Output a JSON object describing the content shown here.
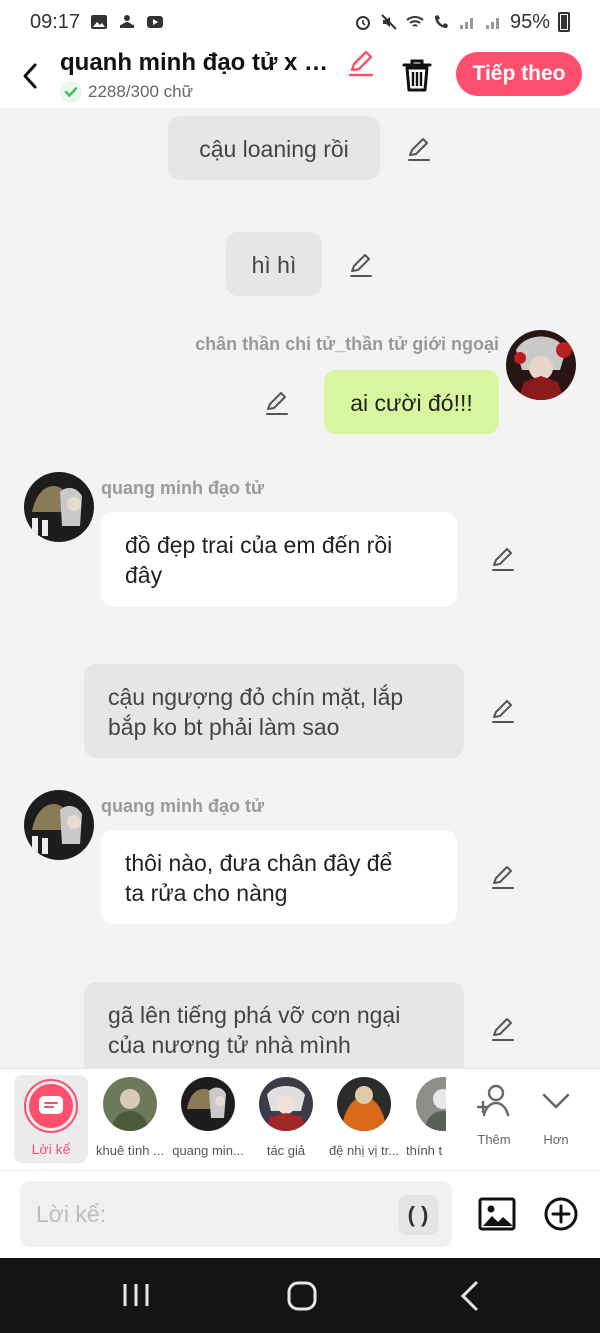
{
  "status_bar": {
    "time": "09:17",
    "battery": "95%"
  },
  "header": {
    "title": "quanh minh đạo tử x c...",
    "word_count": "2288/300 chữ",
    "next_label": "Tiếp theo"
  },
  "messages": {
    "m1": {
      "text": "cậu loaning rồi"
    },
    "m2": {
      "text": "hì hì"
    },
    "m3": {
      "speaker": "chân thần chi tử_thần tử giới ngoại",
      "text": "ai cười đó!!!"
    },
    "m4": {
      "speaker": "quang minh đạo tử",
      "line1": "đồ đẹp trai của em đến rồi",
      "line2": "đây"
    },
    "m5": {
      "line1": "cậu ngượng đỏ chín mặt, lắp",
      "line2": "bắp ko bt phải làm sao"
    },
    "m6": {
      "speaker": "quang minh đạo tử",
      "line1": "thôi nào, đưa chân đây để",
      "line2": "ta rửa cho nàng"
    },
    "m7": {
      "line1": "gã lên tiếng phá vỡ cơn ngại",
      "line2": "của nương tử nhà mình"
    }
  },
  "characters": {
    "narration": "Lời kể",
    "c1": "khuê tình ...",
    "c2": "quang min...",
    "c3": "tác giả",
    "c4": "đệ nhị vị tr...",
    "c5": "thính t",
    "add_label": "Thêm",
    "more_label": "Hơn"
  },
  "input": {
    "placeholder": "Lời kể:",
    "paren": "( )"
  },
  "colors": {
    "accent": "#ff4f6e",
    "user_bubble": "#d8f5a0",
    "narration_bubble": "#e6e6e6",
    "verified": "#3cbf5a"
  }
}
